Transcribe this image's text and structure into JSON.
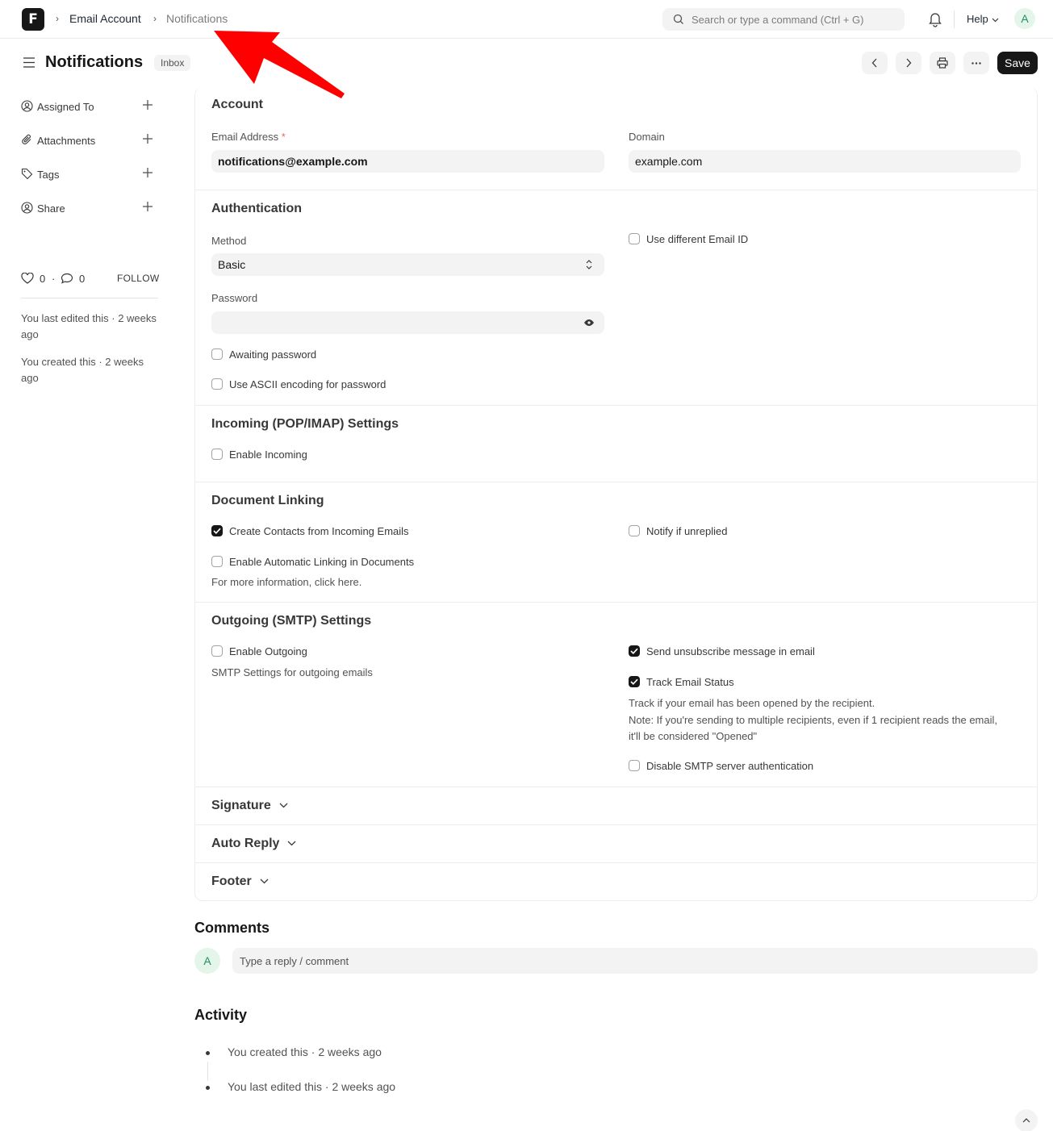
{
  "navbar": {
    "logo_letter": "F",
    "breadcrumbs": [
      "Email Account",
      "Notifications"
    ],
    "search_placeholder": "Search or type a command (Ctrl + G)",
    "help_label": "Help",
    "avatar_initial": "A"
  },
  "page": {
    "title": "Notifications",
    "status_badge": "Inbox",
    "save_label": "Save"
  },
  "sidebar": {
    "items": [
      {
        "label": "Assigned To",
        "icon": "assign-user-icon"
      },
      {
        "label": "Attachments",
        "icon": "paperclip-icon"
      },
      {
        "label": "Tags",
        "icon": "tag-icon"
      },
      {
        "label": "Share",
        "icon": "share-user-icon"
      }
    ],
    "likes": "0",
    "comments": "0",
    "follow_label": "FOLLOW",
    "last_edited": "You last edited this · 2 weeks ago",
    "created": "You created this · 2 weeks ago"
  },
  "form": {
    "account": {
      "title": "Account",
      "email_label": "Email Address",
      "email_required": "*",
      "email_value": "notifications@example.com",
      "domain_label": "Domain",
      "domain_value": "example.com"
    },
    "authentication": {
      "title": "Authentication",
      "method_label": "Method",
      "method_value": "Basic",
      "password_label": "Password",
      "use_different_email": "Use different Email ID",
      "awaiting_password": "Awaiting password",
      "use_ascii": "Use ASCII encoding for password"
    },
    "incoming": {
      "title": "Incoming (POP/IMAP) Settings",
      "enable_incoming": "Enable Incoming"
    },
    "document_linking": {
      "title": "Document Linking",
      "create_contacts": "Create Contacts from Incoming Emails",
      "notify_unreplied": "Notify if unreplied",
      "auto_linking": "Enable Automatic Linking in Documents",
      "more_info": "For more information, click here."
    },
    "outgoing": {
      "title": "Outgoing (SMTP) Settings",
      "enable_outgoing": "Enable Outgoing",
      "smtp_desc": "SMTP Settings for outgoing emails",
      "send_unsubscribe": "Send unsubscribe message in email",
      "track_status": "Track Email Status",
      "track_desc_1": "Track if your email has been opened by the recipient.",
      "track_desc_2": "Note: If you're sending to multiple recipients, even if 1 recipient reads the email,",
      "track_desc_3": "it'll be considered \"Opened\"",
      "disable_smtp_auth": "Disable SMTP server authentication"
    },
    "collapsed": [
      "Signature",
      "Auto Reply",
      "Footer"
    ]
  },
  "checkbox_states": {
    "use_different_email": false,
    "awaiting_password": false,
    "use_ascii": false,
    "enable_incoming": false,
    "create_contacts": true,
    "notify_unreplied": false,
    "auto_linking": false,
    "enable_outgoing": false,
    "send_unsubscribe": true,
    "track_status": true,
    "disable_smtp_auth": false
  },
  "comments": {
    "title": "Comments",
    "avatar_initial": "A",
    "placeholder": "Type a reply / comment"
  },
  "activity": {
    "title": "Activity",
    "items": [
      "You created this · 2 weeks ago",
      "You last edited this · 2 weeks ago"
    ]
  },
  "colors": {
    "primary": "#171717",
    "annotation_arrow": "#ff0000",
    "avatar_bg": "#e4f5e9",
    "avatar_text": "#278f5e"
  }
}
